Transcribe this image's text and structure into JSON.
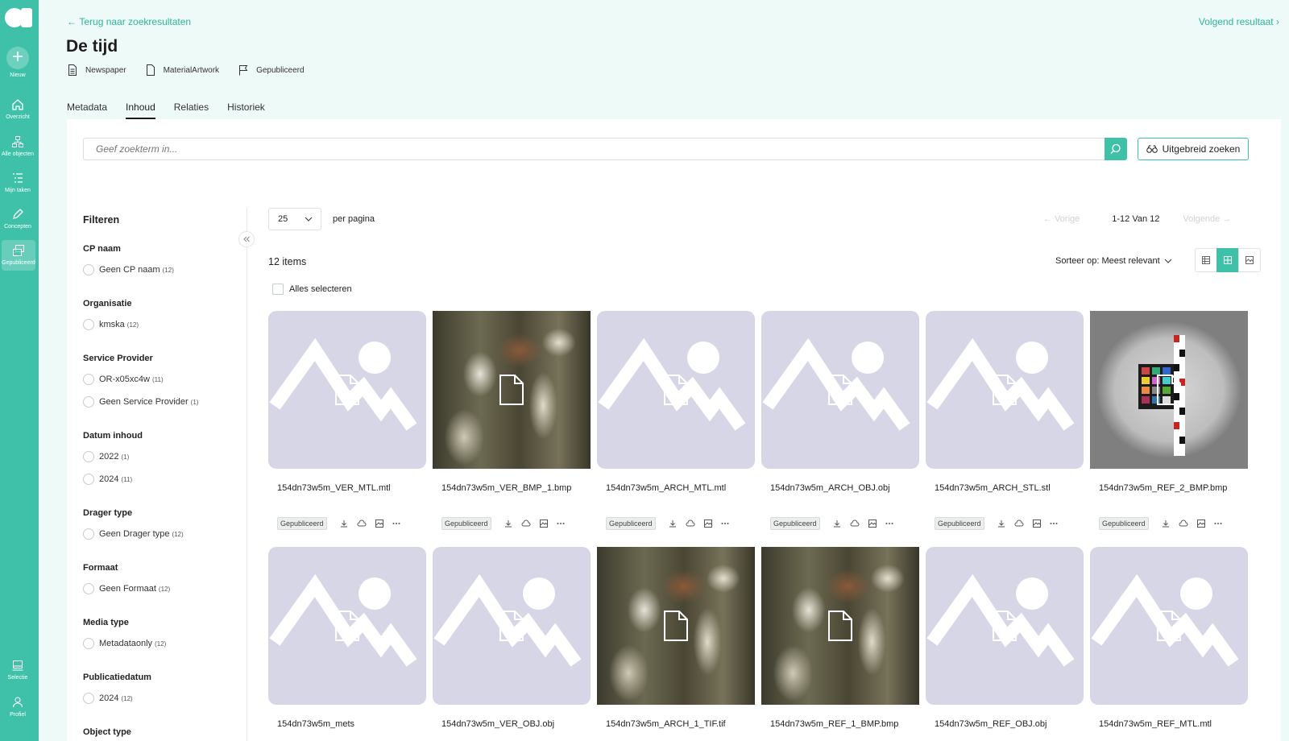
{
  "rail": {
    "new": "Nieuw",
    "items": [
      {
        "label": "Overzicht",
        "icon": "home-icon"
      },
      {
        "label": "Alle objecten",
        "icon": "hierarchy-icon"
      },
      {
        "label": "Mijn taken",
        "icon": "task-list-icon"
      },
      {
        "label": "Concepten",
        "icon": "pencil-icon"
      },
      {
        "label": "Gepubliceerd",
        "icon": "published-icon"
      }
    ],
    "bottom": [
      {
        "label": "Selectie",
        "icon": "inbox-icon"
      },
      {
        "label": "Profiel",
        "icon": "user-icon"
      }
    ]
  },
  "header": {
    "back": "Terug naar zoekresultaten",
    "next": "Volgend resultaat",
    "title": "De tijd",
    "meta": [
      {
        "label": "Newspaper",
        "icon": "document-lines-icon"
      },
      {
        "label": "MaterialArtwork",
        "icon": "document-icon"
      },
      {
        "label": "Gepubliceerd",
        "icon": "flag-icon"
      }
    ],
    "tabs": [
      "Metadata",
      "Inhoud",
      "Relaties",
      "Historiek"
    ],
    "active_tab": "Inhoud"
  },
  "search": {
    "placeholder": "Geef zoekterm in...",
    "advanced": "Uitgebreid zoeken"
  },
  "filters": {
    "title": "Filteren",
    "groups": [
      {
        "title": "CP naam",
        "options": [
          {
            "label": "Geen CP naam",
            "count": "(12)"
          }
        ]
      },
      {
        "title": "Organisatie",
        "options": [
          {
            "label": "kmska",
            "count": "(12)"
          }
        ]
      },
      {
        "title": "Service Provider",
        "options": [
          {
            "label": "OR-x05xc4w",
            "count": "(11)"
          },
          {
            "label": "Geen Service Provider",
            "count": "(1)"
          }
        ]
      },
      {
        "title": "Datum inhoud",
        "options": [
          {
            "label": "2022",
            "count": "(1)"
          },
          {
            "label": "2024",
            "count": "(11)"
          }
        ]
      },
      {
        "title": "Drager type",
        "options": [
          {
            "label": "Geen Drager type",
            "count": "(12)"
          }
        ]
      },
      {
        "title": "Formaat",
        "options": [
          {
            "label": "Geen Formaat",
            "count": "(12)"
          }
        ]
      },
      {
        "title": "Media type",
        "options": [
          {
            "label": "Metadataonly",
            "count": "(12)"
          }
        ]
      },
      {
        "title": "Publicatiedatum",
        "options": [
          {
            "label": "2024",
            "count": "(12)"
          }
        ]
      },
      {
        "title": "Object type",
        "options": []
      }
    ]
  },
  "toolbar": {
    "per_page_value": "25",
    "per_page_label": "per pagina",
    "prev": "Vorige",
    "range": "1-12 Van 12",
    "next": "Volgende",
    "items_count": "12 items",
    "sort": "Sorteer op: Meest relevant",
    "select_all": "Alles selecteren"
  },
  "cards": [
    {
      "name": "154dn73w5m_VER_MTL.mtl",
      "thumb": "placeholder",
      "status": "Gepubliceerd"
    },
    {
      "name": "154dn73w5m_VER_BMP_1.bmp",
      "thumb": "foam",
      "status": "Gepubliceerd"
    },
    {
      "name": "154dn73w5m_ARCH_MTL.mtl",
      "thumb": "placeholder",
      "status": "Gepubliceerd"
    },
    {
      "name": "154dn73w5m_ARCH_OBJ.obj",
      "thumb": "placeholder",
      "status": "Gepubliceerd"
    },
    {
      "name": "154dn73w5m_ARCH_STL.stl",
      "thumb": "placeholder",
      "status": "Gepubliceerd"
    },
    {
      "name": "154dn73w5m_REF_2_BMP.bmp",
      "thumb": "photo",
      "status": "Gepubliceerd"
    },
    {
      "name": "154dn73w5m_mets",
      "thumb": "placeholder",
      "status": ""
    },
    {
      "name": "154dn73w5m_VER_OBJ.obj",
      "thumb": "placeholder",
      "status": ""
    },
    {
      "name": "154dn73w5m_ARCH_1_TIF.tif",
      "thumb": "foam",
      "status": ""
    },
    {
      "name": "154dn73w5m_REF_1_BMP.bmp",
      "thumb": "foam",
      "status": ""
    },
    {
      "name": "154dn73w5m_REF_OBJ.obj",
      "thumb": "placeholder",
      "status": ""
    },
    {
      "name": "154dn73w5m_REF_MTL.mtl",
      "thumb": "placeholder",
      "status": ""
    }
  ],
  "colors": {
    "accent": "#3ec1a8",
    "background": "#eefaf8",
    "placeholder": "#d6d6e7"
  }
}
